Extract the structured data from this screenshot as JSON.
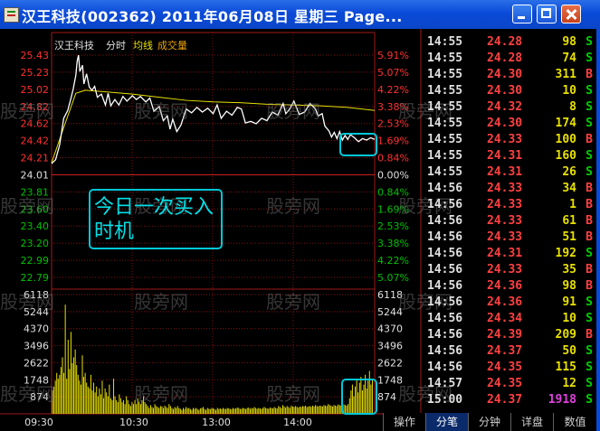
{
  "window": {
    "title": "汉王科技(002362) 2011年06月08日 星期三 Page...",
    "minimize_icon": "minimize-icon",
    "maximize_icon": "maximize-icon",
    "close_icon": "close-icon"
  },
  "legend": {
    "stock_name": "汉王科技",
    "mode": "分时",
    "avg_line": "均线",
    "volume": "成交量"
  },
  "annotation": "今日一次买入时机",
  "watermark": "股旁网",
  "tabs": [
    "操作",
    "分笔",
    "分钟",
    "详盘",
    "数值"
  ],
  "active_tab": "分笔",
  "colors": {
    "up": "#ff4040",
    "down": "#00d000",
    "price_line": "#ffffff",
    "avg_line": "#e8e000",
    "volume": "#e8e000",
    "highlight": "#00c8d8"
  },
  "ticks": [
    {
      "time": "14:55",
      "price": "24.28",
      "vol": "98",
      "side": "S"
    },
    {
      "time": "14:55",
      "price": "24.28",
      "vol": "74",
      "side": "S"
    },
    {
      "time": "14:55",
      "price": "24.30",
      "vol": "311",
      "side": "B"
    },
    {
      "time": "14:55",
      "price": "24.30",
      "vol": "10",
      "side": "S"
    },
    {
      "time": "14:55",
      "price": "24.32",
      "vol": "8",
      "side": "S"
    },
    {
      "time": "14:55",
      "price": "24.30",
      "vol": "174",
      "side": "S"
    },
    {
      "time": "14:55",
      "price": "24.33",
      "vol": "100",
      "side": "B"
    },
    {
      "time": "14:55",
      "price": "24.31",
      "vol": "160",
      "side": "S"
    },
    {
      "time": "14:55",
      "price": "24.31",
      "vol": "26",
      "side": "S"
    },
    {
      "time": "14:56",
      "price": "24.33",
      "vol": "34",
      "side": "B"
    },
    {
      "time": "14:56",
      "price": "24.33",
      "vol": "1",
      "side": "B"
    },
    {
      "time": "14:56",
      "price": "24.33",
      "vol": "61",
      "side": "B"
    },
    {
      "time": "14:56",
      "price": "24.33",
      "vol": "51",
      "side": "B"
    },
    {
      "time": "14:56",
      "price": "24.31",
      "vol": "192",
      "side": "S"
    },
    {
      "time": "14:56",
      "price": "24.33",
      "vol": "35",
      "side": "B"
    },
    {
      "time": "14:56",
      "price": "24.36",
      "vol": "98",
      "side": "B"
    },
    {
      "time": "14:56",
      "price": "24.36",
      "vol": "91",
      "side": "S"
    },
    {
      "time": "14:56",
      "price": "24.34",
      "vol": "10",
      "side": "S"
    },
    {
      "time": "14:56",
      "price": "24.39",
      "vol": "209",
      "side": "B"
    },
    {
      "time": "14:56",
      "price": "24.37",
      "vol": "50",
      "side": "S"
    },
    {
      "time": "14:56",
      "price": "24.35",
      "vol": "115",
      "side": "S"
    },
    {
      "time": "14:57",
      "price": "24.35",
      "vol": "12",
      "side": "S"
    },
    {
      "time": "15:00",
      "price": "24.37",
      "vol": "1918",
      "side": "S"
    }
  ],
  "chart_data": {
    "type": "line",
    "prev_close": 24.01,
    "price_ticks": [
      "25.43",
      "25.23",
      "25.02",
      "24.82",
      "24.62",
      "24.42",
      "24.21",
      "24.01",
      "23.81",
      "23.60",
      "23.40",
      "23.20",
      "22.99",
      "22.79"
    ],
    "pct_ticks": [
      "5.91%",
      "5.07%",
      "4.22%",
      "3.38%",
      "2.53%",
      "1.69%",
      "0.84%",
      "0.00%",
      "0.84%",
      "1.69%",
      "2.53%",
      "3.38%",
      "4.22%",
      "5.07%"
    ],
    "volume_ticks": [
      "6118",
      "5244",
      "4370",
      "3496",
      "2622",
      "1748",
      "874"
    ],
    "time_ticks": [
      "09:30",
      "10:30",
      "13:00",
      "14:00"
    ],
    "ylim": [
      22.58,
      25.43
    ],
    "volume_max": 6118,
    "price_series": [
      [
        0,
        24.04
      ],
      [
        3,
        24.09
      ],
      [
        6,
        24.28
      ],
      [
        9,
        24.62
      ],
      [
        12,
        24.72
      ],
      [
        14,
        24.85
      ],
      [
        16,
        24.99
      ],
      [
        18,
        25.17
      ],
      [
        19,
        25.35
      ],
      [
        20,
        25.43
      ],
      [
        21,
        25.22
      ],
      [
        23,
        25.3
      ],
      [
        24,
        25.06
      ],
      [
        26,
        25.19
      ],
      [
        28,
        25.02
      ],
      [
        30,
        24.98
      ],
      [
        32,
        25.03
      ],
      [
        34,
        24.89
      ],
      [
        37,
        24.93
      ],
      [
        40,
        24.79
      ],
      [
        42,
        24.94
      ],
      [
        44,
        24.78
      ],
      [
        47,
        24.86
      ],
      [
        50,
        24.79
      ],
      [
        53,
        24.9
      ],
      [
        56,
        24.84
      ],
      [
        60,
        24.91
      ],
      [
        63,
        24.86
      ],
      [
        66,
        24.9
      ],
      [
        70,
        24.83
      ],
      [
        73,
        24.88
      ],
      [
        76,
        24.71
      ],
      [
        80,
        24.77
      ],
      [
        83,
        24.59
      ],
      [
        86,
        24.65
      ],
      [
        88,
        24.48
      ],
      [
        90,
        24.61
      ],
      [
        93,
        24.45
      ],
      [
        96,
        24.53
      ],
      [
        100,
        24.74
      ],
      [
        104,
        24.69
      ],
      [
        108,
        24.76
      ],
      [
        112,
        24.7
      ],
      [
        116,
        24.75
      ],
      [
        120,
        24.68
      ],
      [
        123,
        24.79
      ],
      [
        126,
        24.62
      ],
      [
        130,
        24.71
      ],
      [
        134,
        24.66
      ],
      [
        138,
        24.76
      ],
      [
        141,
        24.74
      ],
      [
        144,
        24.56
      ],
      [
        148,
        24.58
      ],
      [
        152,
        24.55
      ],
      [
        156,
        24.62
      ],
      [
        160,
        24.59
      ],
      [
        164,
        24.7
      ],
      [
        168,
        24.66
      ],
      [
        172,
        24.81
      ],
      [
        174,
        24.68
      ],
      [
        177,
        24.74
      ],
      [
        180,
        24.84
      ],
      [
        184,
        24.67
      ],
      [
        188,
        24.7
      ],
      [
        192,
        24.81
      ],
      [
        196,
        24.74
      ],
      [
        198,
        24.65
      ],
      [
        201,
        24.68
      ],
      [
        203,
        24.52
      ],
      [
        206,
        24.46
      ],
      [
        208,
        24.38
      ],
      [
        210,
        24.44
      ],
      [
        212,
        24.36
      ],
      [
        214,
        24.45
      ],
      [
        216,
        24.34
      ],
      [
        218,
        24.4
      ],
      [
        220,
        24.35
      ],
      [
        222,
        24.41
      ],
      [
        225,
        24.37
      ],
      [
        228,
        24.32
      ],
      [
        231,
        24.36
      ],
      [
        234,
        24.34
      ],
      [
        237,
        24.37
      ],
      [
        240,
        24.35
      ]
    ],
    "avg_series": [
      [
        0,
        24.05
      ],
      [
        10,
        24.55
      ],
      [
        18,
        24.94
      ],
      [
        25,
        24.98
      ],
      [
        40,
        24.96
      ],
      [
        60,
        24.93
      ],
      [
        80,
        24.89
      ],
      [
        100,
        24.85
      ],
      [
        120,
        24.83
      ],
      [
        140,
        24.82
      ],
      [
        160,
        24.8
      ],
      [
        180,
        24.79
      ],
      [
        200,
        24.78
      ],
      [
        220,
        24.76
      ],
      [
        240,
        24.72
      ]
    ],
    "volumes": [
      1200,
      1400,
      1700,
      2100,
      1800,
      2000,
      2400,
      2900,
      2100,
      5600,
      1800,
      3800,
      2300,
      4200,
      2600,
      2900,
      3300,
      2500,
      2000,
      1700,
      1500,
      3000,
      1900,
      2100,
      1600,
      1400,
      1300,
      2000,
      1200,
      1600,
      1100,
      1400,
      900,
      1300,
      1000,
      1700,
      800,
      1300,
      1100,
      900,
      1500,
      800,
      700,
      1800,
      900,
      700,
      600,
      1000,
      800,
      600,
      700,
      500,
      900,
      700,
      500,
      400,
      600,
      500,
      700,
      500,
      800,
      600,
      500,
      700,
      900,
      600,
      500,
      400,
      300,
      450,
      350,
      300,
      500,
      400,
      350,
      300,
      400,
      380,
      300,
      420,
      350,
      300,
      500,
      400,
      300,
      250,
      350,
      300,
      400,
      300,
      260,
      200,
      300,
      250,
      350,
      280,
      300,
      250,
      200,
      300,
      260,
      300,
      250,
      200,
      280,
      300,
      350,
      250,
      200,
      300,
      260,
      240,
      300,
      280,
      250,
      200,
      300,
      250,
      280,
      240,
      300,
      260,
      250,
      300,
      280,
      250,
      240,
      300,
      260,
      280,
      320,
      300,
      250,
      260,
      300,
      280,
      250,
      300,
      320,
      260,
      300,
      280,
      350,
      300,
      260,
      300,
      280,
      250,
      300,
      350,
      300,
      280,
      260,
      320,
      300,
      280,
      350,
      300,
      280,
      400,
      350,
      300,
      450,
      380,
      320,
      400,
      350,
      300,
      420,
      380,
      350,
      400,
      360,
      320,
      380,
      350,
      400,
      380,
      420,
      350,
      380,
      400,
      360,
      420,
      380,
      450,
      400,
      380,
      420,
      400,
      380,
      450,
      420,
      400,
      500,
      450,
      420,
      380,
      450,
      420,
      400,
      480,
      450,
      420,
      500,
      480,
      450,
      420,
      500,
      800,
      1200,
      1500,
      900,
      1400,
      1800,
      1100,
      1600,
      1900,
      1200,
      1500,
      2000,
      1300,
      1700,
      2200,
      1500,
      1800
    ]
  }
}
